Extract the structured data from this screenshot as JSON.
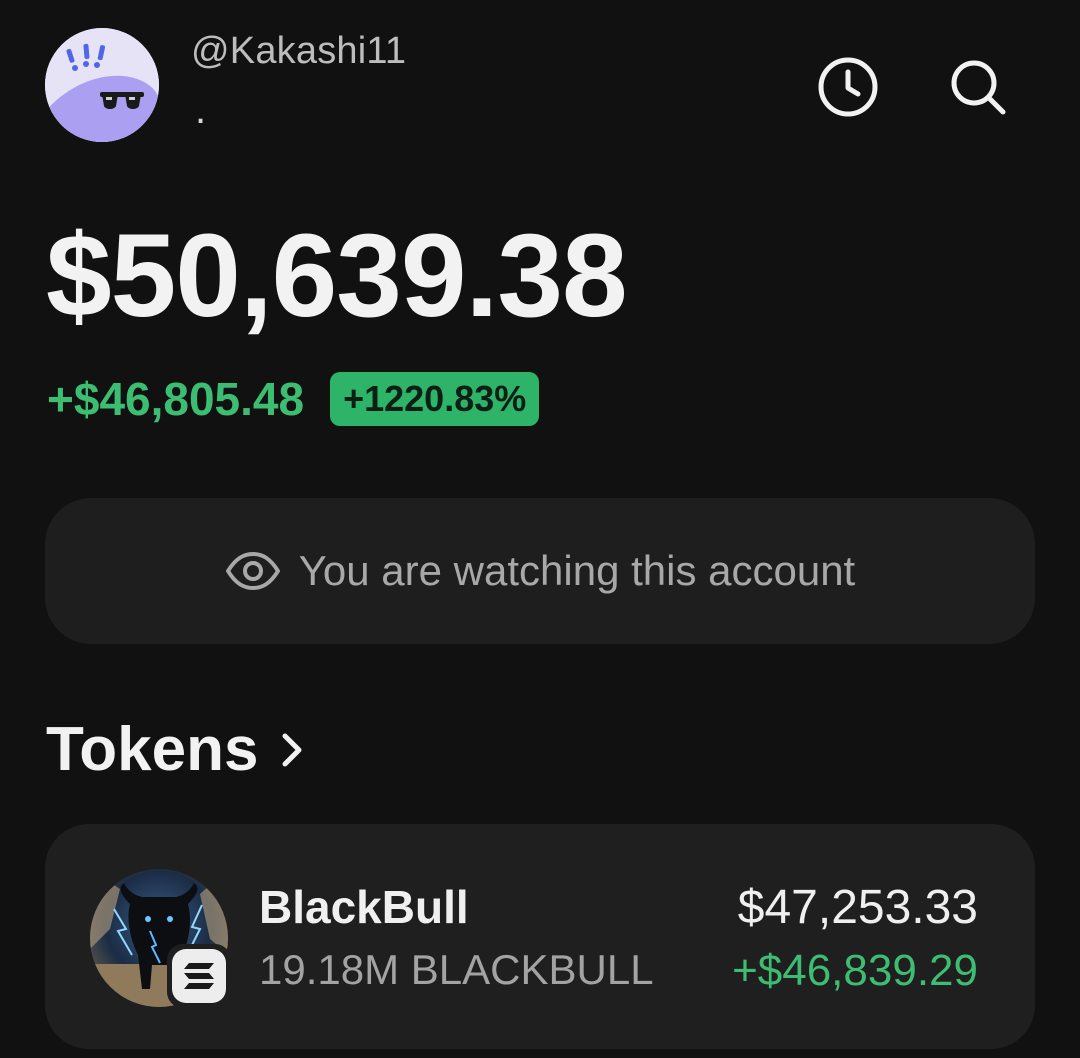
{
  "header": {
    "username": "@Kakashi11",
    "subtitle": "."
  },
  "icons": {
    "avatar": "sunglasses-avatar",
    "history": "clock-icon",
    "search": "search-icon",
    "watch": "eye-icon",
    "section_chevron": "chevron-right-icon",
    "token_logo": "black-bull-image",
    "chain_badge": "solana-icon"
  },
  "portfolio": {
    "balance": "$50,639.38",
    "change_amount": "+$46,805.48",
    "change_percent": "+1220.83%"
  },
  "watch_banner": {
    "text": "You are watching this account"
  },
  "tokens_section": {
    "title": "Tokens"
  },
  "tokens": [
    {
      "name": "BlackBull",
      "amount": "19.18M BLACKBULL",
      "value": "$47,253.33",
      "pnl": "+$46,839.29"
    }
  ],
  "colors": {
    "background": "#111111",
    "card": "#1f1f1f",
    "positive": "#3dbd72",
    "badge": "#2db469"
  }
}
